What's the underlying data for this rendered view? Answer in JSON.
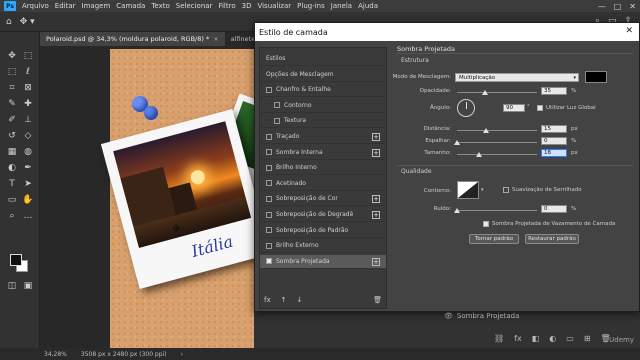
{
  "menu": {
    "app_icon": "Ps",
    "items": [
      "Arquivo",
      "Editar",
      "Imagem",
      "Camada",
      "Texto",
      "Selecionar",
      "Filtro",
      "3D",
      "Visualizar",
      "Plug-ins",
      "Janela",
      "Ajuda"
    ],
    "window_controls": [
      "—",
      "□",
      "✕"
    ]
  },
  "tabs": [
    {
      "label": "Polaroid.psd @ 34,3% (moldura polaroid, RGB/8) *",
      "close": "×"
    },
    {
      "label": "alfinetes.p"
    }
  ],
  "canvas": {
    "caption": "Itália"
  },
  "dialog": {
    "title": "Estilo de camada",
    "close": "✕",
    "styles_list": [
      {
        "label": "Estilos",
        "checkbox": false,
        "plus": false
      },
      {
        "label": "Opções de Mesclagem",
        "checkbox": false,
        "plus": false
      },
      {
        "label": "Chanfro & Entalhe",
        "checkbox": true,
        "checked": false,
        "plus": false
      },
      {
        "label": "Contorno",
        "checkbox": true,
        "checked": false,
        "plus": false
      },
      {
        "label": "Textura",
        "checkbox": true,
        "checked": false,
        "plus": false
      },
      {
        "label": "Traçado",
        "checkbox": true,
        "checked": false,
        "plus": true
      },
      {
        "label": "Sombra Interna",
        "checkbox": true,
        "checked": false,
        "plus": true
      },
      {
        "label": "Brilho Interno",
        "checkbox": true,
        "checked": false,
        "plus": false
      },
      {
        "label": "Acetinado",
        "checkbox": true,
        "checked": false,
        "plus": false
      },
      {
        "label": "Sobreposição de Cor",
        "checkbox": true,
        "checked": false,
        "plus": true
      },
      {
        "label": "Sobreposição de Degradê",
        "checkbox": true,
        "checked": false,
        "plus": true
      },
      {
        "label": "Sobreposição de Padrão",
        "checkbox": true,
        "checked": false,
        "plus": false
      },
      {
        "label": "Brilho Externo",
        "checkbox": true,
        "checked": false,
        "plus": false
      },
      {
        "label": "Sombra Projetada",
        "checkbox": true,
        "checked": true,
        "plus": true,
        "selected": true
      }
    ],
    "list_footer": {
      "fx": "fx",
      "up": "↑",
      "down": "↓",
      "trash": "🗑"
    },
    "section_title": "Sombra Projetada",
    "structure_title": "Estrutura",
    "blend_mode_label": "Modo de Mesclagem:",
    "blend_mode_value": "Multiplicação",
    "shadow_color": "#000000",
    "opacity_label": "Opacidade:",
    "opacity_value": "35",
    "opacity_unit": "%",
    "angle_label": "Ângulo:",
    "angle_value": "90",
    "angle_unit": "°",
    "global_light_label": "Utilizar Luz Global",
    "global_light_checked": true,
    "distance_label": "Distância:",
    "distance_value": "15",
    "distance_unit": "px",
    "spread_label": "Espalhar:",
    "spread_value": "0",
    "spread_unit": "%",
    "size_label": "Tamanho:",
    "size_value": "18",
    "size_unit": "px",
    "quality_title": "Qualidade",
    "contour_label": "Contorno:",
    "antialias_label": "Suavização de Serrilhado",
    "antialias_checked": false,
    "noise_label": "Ruído:",
    "noise_value": "0",
    "noise_unit": "%",
    "knockout_label": "Sombra Projetada de Vazamento de Camada",
    "knockout_checked": true,
    "default_button": "Tornar padrão",
    "reset_button": "Restaurar padrão"
  },
  "layers": {
    "effect_row": "Sombra Projetada"
  },
  "status": {
    "zoom": "34,28%",
    "doc_info": "3508 px x 2480 px (300 ppi)"
  },
  "watermark": "Udemy"
}
